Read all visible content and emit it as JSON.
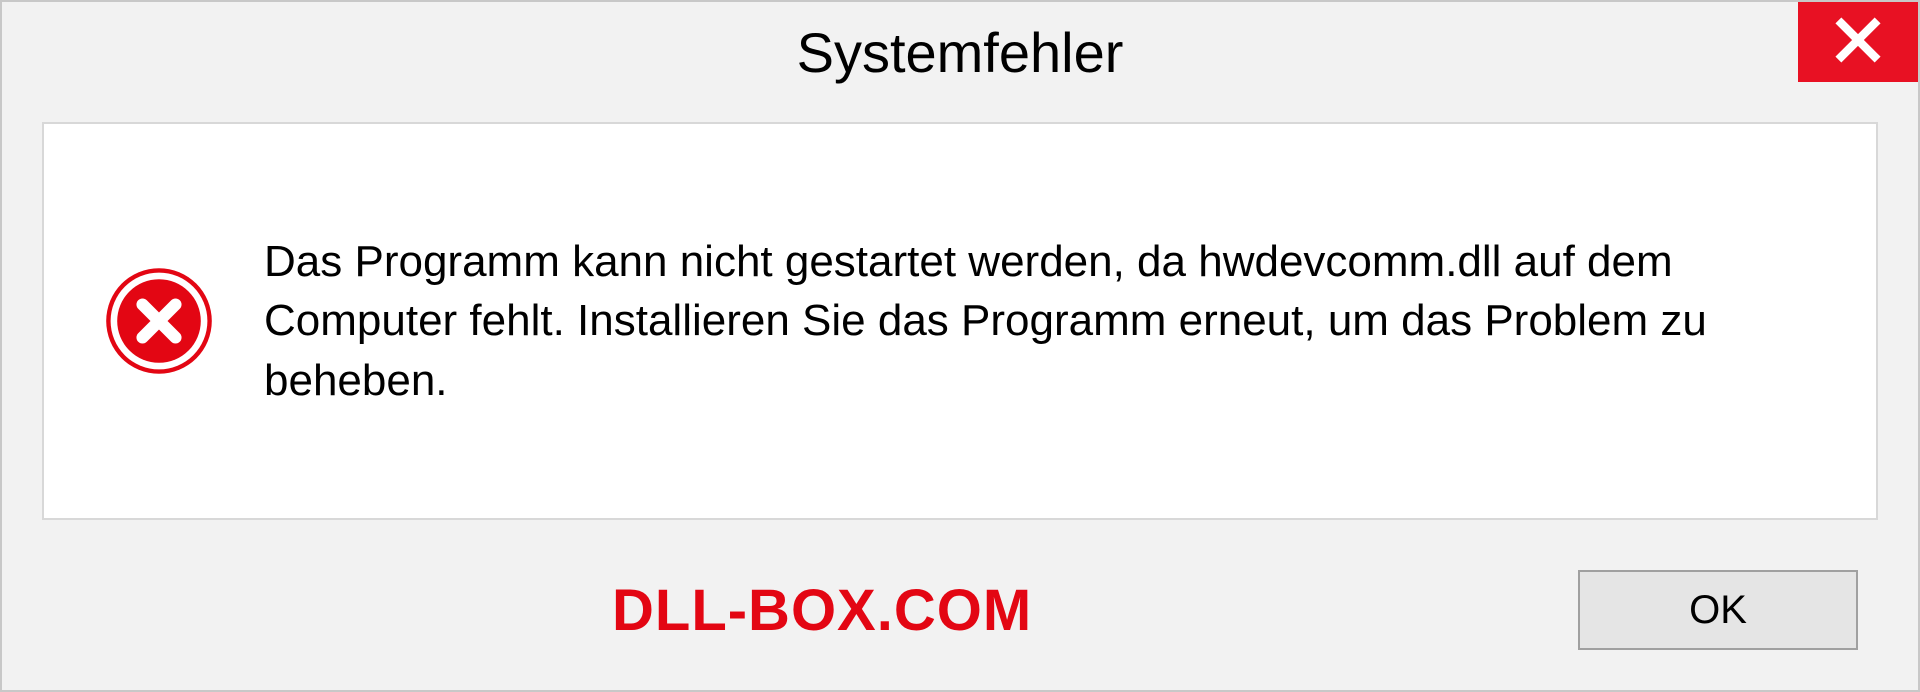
{
  "dialog": {
    "title": "Systemfehler",
    "message": "Das Programm kann nicht gestartet werden, da hwdevcomm.dll auf dem Computer fehlt. Installieren Sie das Programm erneut, um das Problem zu beheben.",
    "ok_label": "OK",
    "watermark": "DLL-BOX.COM"
  }
}
